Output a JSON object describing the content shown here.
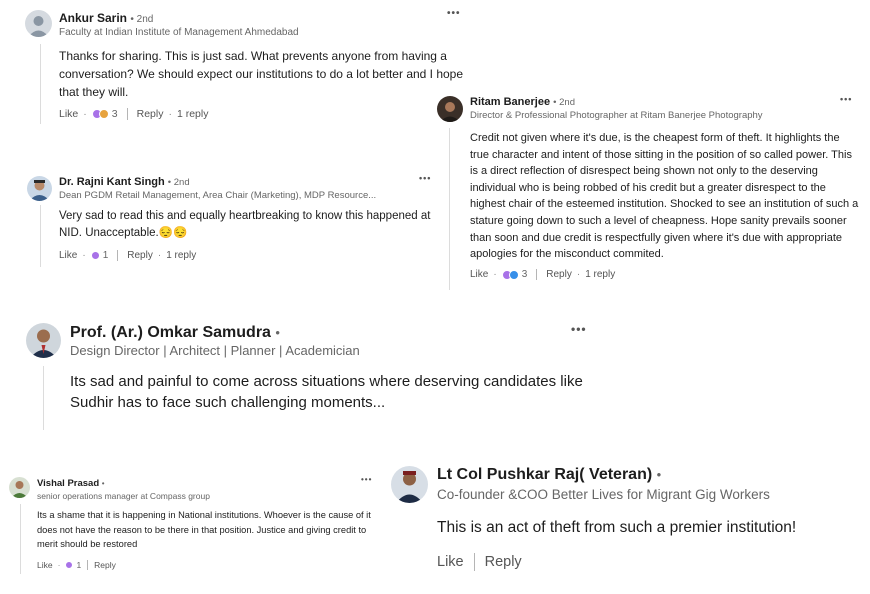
{
  "comments": [
    {
      "name": "Ankur Sarin",
      "degree": "• 2nd",
      "headline": "Faculty at Indian Institute of Management Ahmedabad",
      "text": "Thanks for sharing. This is just sad. What prevents anyone from having a conversation? We should expect our institutions to do a lot better and I hope that they will.",
      "like": "Like",
      "reactions": "3",
      "reply": "Reply",
      "replies": "1 reply"
    },
    {
      "name": "Dr. Rajni Kant Singh",
      "degree": "• 2nd",
      "headline": "Dean PGDM Retail Management, Area Chair (Marketing), MDP Resource...",
      "text": "Very sad to read this and equally heartbreaking to know this happened at NID. Unacceptable.😔😔",
      "like": "Like",
      "reactions": "1",
      "reply": "Reply",
      "replies": "1 reply"
    },
    {
      "name": "Ritam Banerjee",
      "degree": "• 2nd",
      "headline": "Director & Professional Photographer at Ritam Banerjee Photography",
      "text": "Credit not given where it's due, is the cheapest form of theft. It highlights the true character and intent of those sitting in the position of so called power. This is a direct reflection of disrespect being shown not only to the deserving individual who is being robbed of his credit but a greater disrespect to the highest chair of the esteemed institution. Shocked to see an institution of such a stature going down to such a level of cheapness. Hope sanity prevails sooner than soon and due credit is respectfully given where it's due with appropriate apologies for the misconduct commited.",
      "like": "Like",
      "reactions": "3",
      "reply": "Reply",
      "replies": "1 reply"
    },
    {
      "name": "Prof. (Ar.) Omkar Samudra",
      "degree": "•",
      "headline": "Design Director | Architect | Planner | Academician",
      "text": "Its sad and painful to come across situations where deserving candidates like Sudhir has to face such challenging moments..."
    },
    {
      "name": "Vishal Prasad",
      "degree": "•",
      "headline": "senior operations manager at Compass group",
      "text": "Its a shame that it is happening in National institutions. Whoever is the cause of it does not have the reason to be there in that position. Justice and giving credit to merit should be restored",
      "like": "Like",
      "reactions": "1",
      "reply": "Reply"
    },
    {
      "name": "Lt Col Pushkar Raj( Veteran)",
      "degree": "•",
      "headline": "Co-founder &COO Better Lives for Migrant Gig Workers",
      "text": "This is an act of theft from such a premier institution!",
      "like": "Like",
      "reply": "Reply"
    }
  ],
  "more_label": "•••",
  "icons": [
    "more-options-icon",
    "like-reaction-icon",
    "celebrate-reaction-icon",
    "love-reaction-icon",
    "support-reaction-icon"
  ],
  "colors": {
    "text": "#1d1d1d",
    "muted": "#666666",
    "like_blue": "#378fe9",
    "celebrate_green": "#6dae4f",
    "love_red": "#df704d",
    "support_purple": "#a872e8"
  }
}
